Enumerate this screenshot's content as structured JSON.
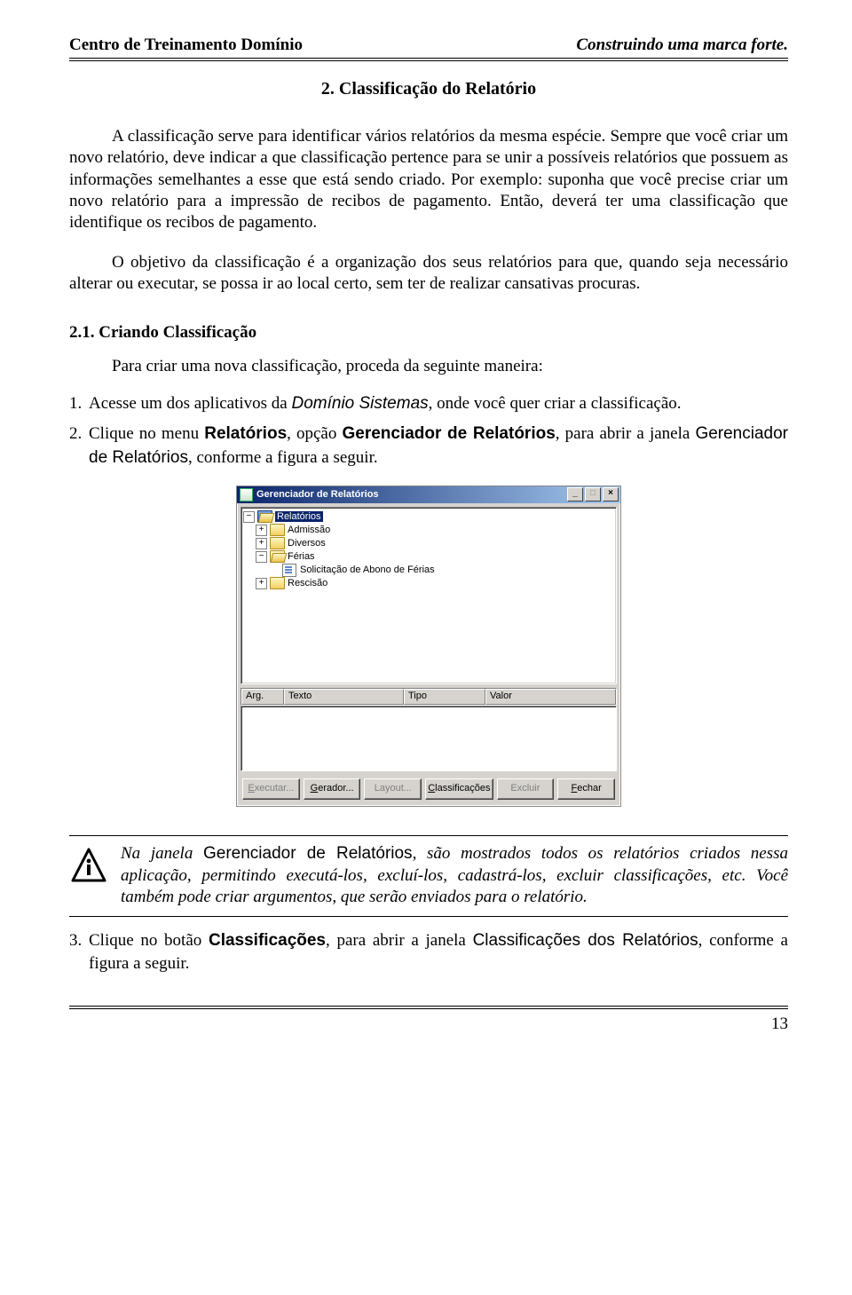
{
  "header": {
    "left": "Centro de Treinamento Domínio",
    "right": "Construindo uma marca forte."
  },
  "section_title": "2. Classificação do Relatório",
  "para1": "A classificação serve para identificar vários relatórios da mesma espécie. Sempre que você criar um novo relatório, deve indicar a que classificação pertence para se unir a possíveis relatórios que possuem as informações semelhantes a esse que está sendo criado. Por exemplo: suponha que você precise criar um novo relatório para a impressão de recibos de pagamento. Então, deverá ter uma classificação que identifique os recibos de pagamento.",
  "para2": "O objetivo da classificação é a organização dos seus relatórios para que, quando seja necessário alterar ou executar, se possa ir ao local certo, sem ter de realizar cansativas procuras.",
  "subsection_title": "2.1. Criando Classificação",
  "lead_in": "Para criar uma nova classificação, proceda da seguinte maneira:",
  "step1": {
    "num": "1.",
    "t1": "Acesse um dos aplicativos da ",
    "brand": "Domínio Sistemas",
    "t2": ", onde você quer criar a classificação."
  },
  "step2": {
    "num": "2.",
    "t1": "Clique no menu ",
    "menu": "Relatórios",
    "t2": ", opção ",
    "option": "Gerenciador de Relatórios",
    "t3": ", para abrir a janela ",
    "window": "Gerenciador de Relatórios",
    "t4": ", conforme a figura a seguir."
  },
  "app": {
    "title": "Gerenciador de Relatórios",
    "tree": {
      "root": "Relatórios",
      "items": [
        {
          "glyph": "+",
          "label": "Admissão"
        },
        {
          "glyph": "+",
          "label": "Diversos"
        },
        {
          "glyph": "−",
          "label": "Férias"
        },
        {
          "glyph": "",
          "label": "Solicitação de Abono de Férias",
          "child": true
        },
        {
          "glyph": "+",
          "label": "Rescisão"
        }
      ]
    },
    "grid_headers": [
      "Arg.",
      "Texto",
      "Tipo",
      "Valor"
    ],
    "buttons": {
      "executar": "Executar...",
      "gerador": "Gerador...",
      "layout": "Layout...",
      "classificacoes": "Classificações",
      "excluir": "Excluir",
      "fechar": "Fechar"
    },
    "win_buttons": {
      "min": "_",
      "max": "□",
      "close": "×"
    }
  },
  "info": {
    "t1": "Na janela ",
    "win": "Gerenciador de Relatórios",
    "t2": ", são mostrados todos os relatórios criados nessa aplicação, permitindo executá-los, excluí-los, cadastrá-los, excluir classificações, etc. Você também pode criar argumentos, que serão enviados para o relatório."
  },
  "step3": {
    "num": "3.",
    "t1": "Clique no botão ",
    "btn": "Classificações",
    "t2": ", para abrir a janela ",
    "win": "Classificações dos Relatórios",
    "t3": ", conforme a figura a seguir."
  },
  "page_number": "13"
}
